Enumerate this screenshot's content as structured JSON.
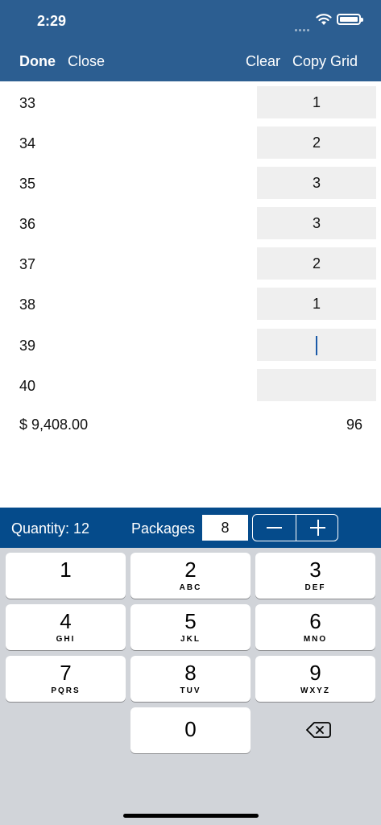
{
  "status_bar": {
    "time": "2:29"
  },
  "nav": {
    "done": "Done",
    "close": "Close",
    "clear": "Clear",
    "copy_grid": "Copy Grid"
  },
  "rows": [
    {
      "label": "33",
      "value": "1"
    },
    {
      "label": "34",
      "value": "2"
    },
    {
      "label": "35",
      "value": "3"
    },
    {
      "label": "36",
      "value": "3"
    },
    {
      "label": "37",
      "value": "2"
    },
    {
      "label": "38",
      "value": "1"
    },
    {
      "label": "39",
      "value": ""
    },
    {
      "label": "40",
      "value": ""
    }
  ],
  "summary": {
    "total": "$ 9,408.00",
    "count": "96"
  },
  "toolbar": {
    "quantity": "Quantity: 12",
    "packages_label": "Packages",
    "packages_value": "8"
  },
  "keypad": [
    {
      "digit": "1",
      "letters": ""
    },
    {
      "digit": "2",
      "letters": "ABC"
    },
    {
      "digit": "3",
      "letters": "DEF"
    },
    {
      "digit": "4",
      "letters": "GHI"
    },
    {
      "digit": "5",
      "letters": "JKL"
    },
    {
      "digit": "6",
      "letters": "MNO"
    },
    {
      "digit": "7",
      "letters": "PQRS"
    },
    {
      "digit": "8",
      "letters": "TUV"
    },
    {
      "digit": "9",
      "letters": "WXYZ"
    },
    {
      "digit": "0",
      "letters": ""
    }
  ],
  "colors": {
    "header": "#2c5e91",
    "toolbar": "#054b8b",
    "cell_bg": "#efefef",
    "keyboard_bg": "#d1d4d9"
  }
}
